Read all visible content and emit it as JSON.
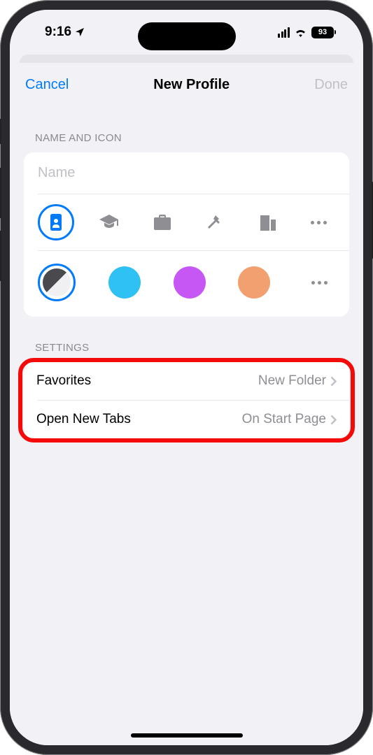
{
  "status": {
    "time": "9:16",
    "battery": "93"
  },
  "modal": {
    "cancel": "Cancel",
    "title": "New Profile",
    "done": "Done"
  },
  "name_section": {
    "header": "NAME AND ICON",
    "placeholder": "Name",
    "icons": [
      "id-card",
      "graduation-cap",
      "briefcase",
      "hammer",
      "building",
      "more"
    ],
    "selected_icon": "id-card",
    "colors": [
      "two-tone",
      "#2fc1f3",
      "#c657f5",
      "#f3a070"
    ],
    "selected_color": "two-tone"
  },
  "settings_section": {
    "header": "SETTINGS",
    "rows": [
      {
        "label": "Favorites",
        "value": "New Folder"
      },
      {
        "label": "Open New Tabs",
        "value": "On Start Page"
      }
    ]
  }
}
